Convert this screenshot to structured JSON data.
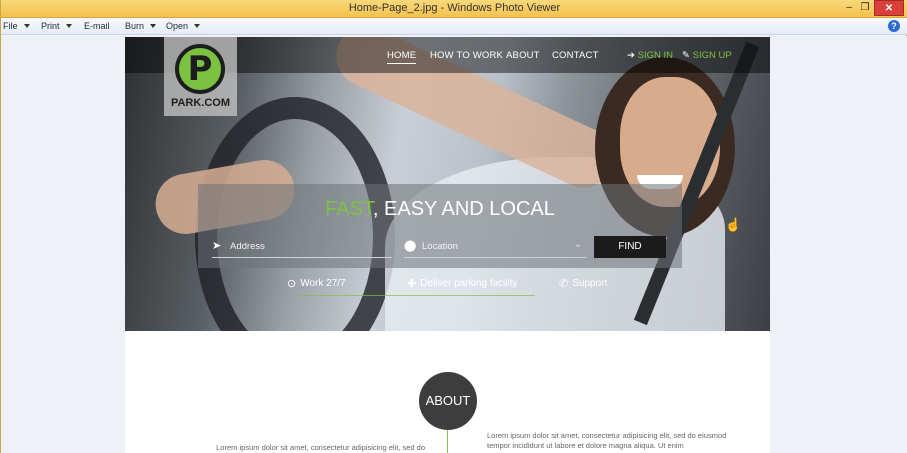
{
  "window": {
    "title": "Home-Page_2.jpg - Windows Photo Viewer",
    "min_glyph": "–",
    "max_glyph": "❐",
    "close_glyph": "✕"
  },
  "menu": {
    "file": "File",
    "print": "Print",
    "email": "E-mail",
    "burn": "Burn",
    "open": "Open",
    "help": "?"
  },
  "site": {
    "logo_letter": "P",
    "brand": "PARK.COM",
    "nav": [
      "HOME",
      "HOW TO WORK",
      "ABOUT",
      "CONTACT"
    ],
    "sign_in": "SIGN IN",
    "sign_up": "SIGN UP",
    "headline_accent": "FAST",
    "headline_rest": ", EASY AND LOCAL",
    "address_placeholder": "Address",
    "location_placeholder": "Location",
    "find_label": "FIND",
    "features": [
      "Work 27/7",
      "Deliver parking facility",
      "Support"
    ],
    "about_label": "ABOUT",
    "lorem_left": "Lorem ipsum dolor sit amet, consectetur adipisicing elit, sed do",
    "lorem_right": "Lorem ipsum dolor sit amet, consectetur adipisicing elit, sed do eiusmod tempor incididunt ut labore et dolore magna aliqua. Ut enim"
  },
  "colors": {
    "accent_green": "#7cc242",
    "titlebar": "#f3c24e",
    "close_red": "#d9403a"
  }
}
